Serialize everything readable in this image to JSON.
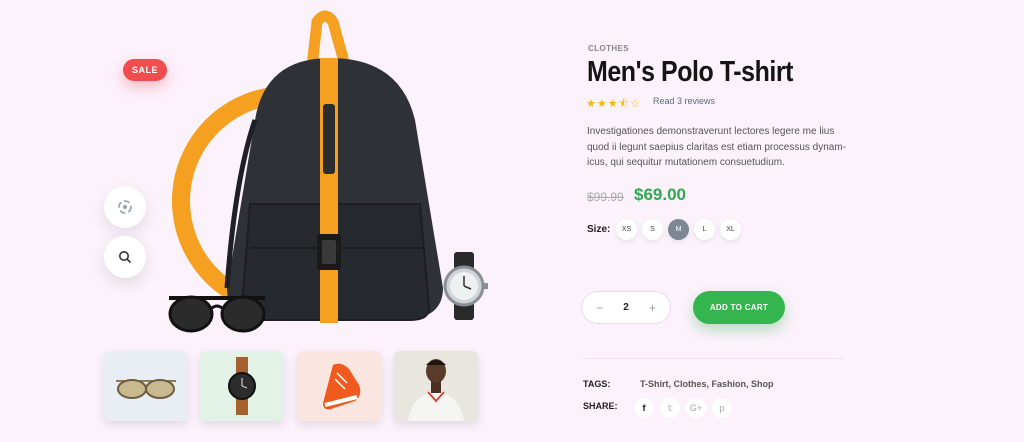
{
  "badge": {
    "sale": "SALE"
  },
  "product": {
    "category": "CLOTHES",
    "title": "Men's Polo T-shirt",
    "rating": {
      "stars": "★★★⯪☆",
      "value": 3.5,
      "reviews_label": "Read 3 reviews"
    },
    "description": "Investigationes demonstraverunt lectores legere me lius quod ii legunt saepius claritas est etiam processus dynam-icus, qui sequitur mutationem consuetudium.",
    "old_price": "$99.99",
    "price": "$69.00",
    "size_label": "Size:",
    "sizes": [
      "XS",
      "S",
      "M",
      "L",
      "XL"
    ],
    "selected_size": "M",
    "quantity": {
      "minus": "−",
      "value": "2",
      "plus": "+"
    },
    "add_to_cart": "ADD TO CART",
    "tags_label": "TAGS:",
    "tags": "T-Shirt, Clothes, Fashion, Shop",
    "share_label": "SHARE:",
    "share": {
      "facebook": "f",
      "twitter": "𝕥",
      "google": "G+",
      "pinterest": "p"
    }
  },
  "colors": {
    "background": "#fcf2fc",
    "accent_orange": "#f6a021",
    "sale_red": "#f04e4e",
    "price_green": "#2fa84f",
    "cart_green": "#34b54e"
  },
  "icons": [
    "rotate-360-icon",
    "search-icon"
  ],
  "thumbnails": [
    "sunglasses",
    "wristwatch",
    "sneaker",
    "man-in-white-shirt"
  ]
}
